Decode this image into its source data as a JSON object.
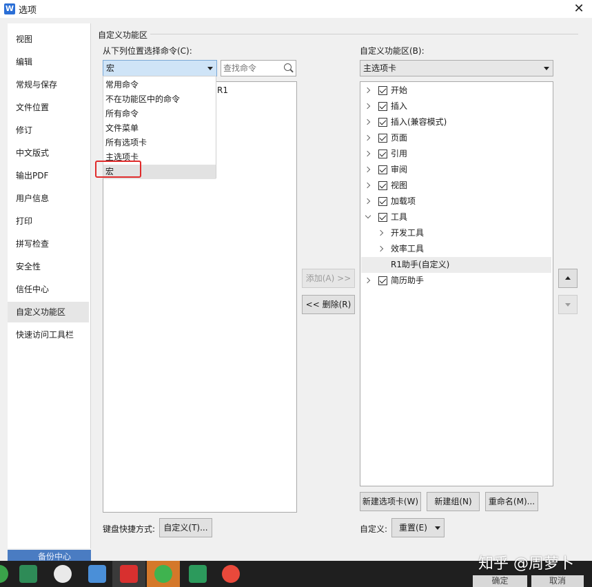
{
  "window": {
    "title": "选项",
    "app_icon_letter": "W"
  },
  "nav": {
    "items": [
      "视图",
      "编辑",
      "常规与保存",
      "文件位置",
      "修订",
      "中文版式",
      "输出PDF",
      "用户信息",
      "打印",
      "拼写检查",
      "安全性",
      "信任中心",
      "自定义功能区",
      "快速访问工具栏"
    ],
    "active_index": 12
  },
  "section_title": "自定义功能区",
  "left_panel": {
    "label": "从下列位置选择命令(C):",
    "combo_value": "宏",
    "search_placeholder": "查找命令",
    "dropdown_items": [
      "常用命令",
      "不在功能区中的命令",
      "所有命令",
      "文件菜单",
      "所有选项卡",
      "主选项卡",
      "宏"
    ],
    "highlighted_item": "宏",
    "list_peek_text": "R1"
  },
  "right_panel": {
    "label": "自定义功能区(B):",
    "combo_value": "主选项卡",
    "tree": [
      {
        "label": "开始",
        "checked": true,
        "level": 0,
        "expanded": false
      },
      {
        "label": "插入",
        "checked": true,
        "level": 0,
        "expanded": false
      },
      {
        "label": "插入(兼容模式)",
        "checked": true,
        "level": 0,
        "expanded": false
      },
      {
        "label": "页面",
        "checked": true,
        "level": 0,
        "expanded": false
      },
      {
        "label": "引用",
        "checked": true,
        "level": 0,
        "expanded": false
      },
      {
        "label": "审阅",
        "checked": true,
        "level": 0,
        "expanded": false
      },
      {
        "label": "视图",
        "checked": true,
        "level": 0,
        "expanded": false
      },
      {
        "label": "加载项",
        "checked": true,
        "level": 0,
        "expanded": false
      },
      {
        "label": "工具",
        "checked": true,
        "level": 0,
        "expanded": true
      },
      {
        "label": "开发工具",
        "level": 1,
        "expanded": false
      },
      {
        "label": "效率工具",
        "level": 1,
        "expanded": false
      },
      {
        "label": "R1助手(自定义)",
        "level": 2,
        "selected": true
      },
      {
        "label": "简历助手",
        "checked": true,
        "level": 0,
        "expanded": false
      }
    ]
  },
  "buttons": {
    "add": "添加(A) >>",
    "remove": "<< 删除(R)",
    "new_tab": "新建选项卡(W)",
    "new_group": "新建组(N)",
    "rename": "重命名(M)...",
    "customize_shortcut": "自定义(T)...",
    "reset": "重置(E)"
  },
  "labels": {
    "keyboard_shortcut": "键盘快捷方式:",
    "customize": "自定义:"
  },
  "backup_label": "备份中心",
  "footer": {
    "ok": "确定",
    "cancel": "取消"
  },
  "watermark": "知乎 @周萝卜",
  "colors": {
    "highlight_box": "#e02b2b",
    "selected_combo": "#cfe4f7",
    "taskbar": "#1f1f1f"
  }
}
